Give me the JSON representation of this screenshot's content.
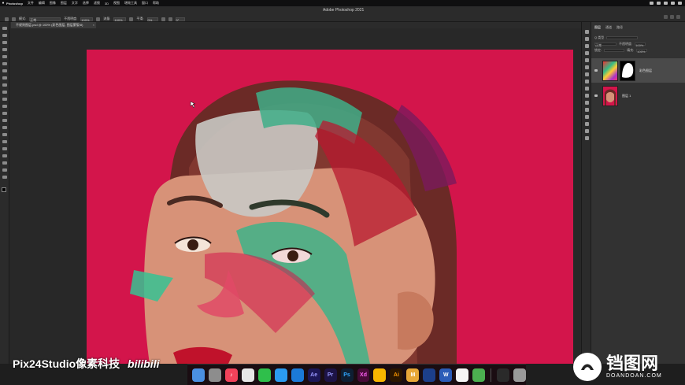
{
  "menubar": {
    "app": "Photoshop",
    "items": [
      "文件",
      "编辑",
      "图像",
      "图层",
      "文字",
      "选择",
      "滤镜",
      "3D",
      "视图",
      "增效工具",
      "窗口",
      "帮助"
    ]
  },
  "optionsbar": {
    "app_title": "Adobe Photoshop 2021",
    "mode_label": "模式:",
    "mode_value": "正常",
    "opacity_label": "不透明度:",
    "opacity_value": "100%",
    "flow_label": "流量:",
    "flow_value": "100%",
    "smoothing_label": "平滑:",
    "smoothing_value": "0%",
    "angle_value": "0°"
  },
  "tab": {
    "label": "不规则图层.psd @ 100% (彩色图层, 图层蒙版/8)",
    "close": "×"
  },
  "layers_panel": {
    "tabs": [
      "图层",
      "通道",
      "路径"
    ],
    "kind_label": "Q 类型",
    "blend_mode": "正常",
    "opacity_label": "不透明度:",
    "opacity_value": "100%",
    "lock_label": "锁定:",
    "fill_label": "填充:",
    "fill_value": "100%",
    "layers": [
      {
        "name": "彩色图层",
        "selected": true
      },
      {
        "name": "图层 1",
        "selected": false
      }
    ]
  },
  "dock": {
    "apps": [
      {
        "icon": "finder-icon",
        "label": "",
        "color": "#4a8fe0"
      },
      {
        "icon": "launchpad-icon",
        "label": "",
        "color": "#8d8d8d"
      },
      {
        "icon": "music-icon",
        "label": "♪",
        "color": "#f2425a"
      },
      {
        "icon": "chrome-icon",
        "label": "",
        "color": "#e7e7e7"
      },
      {
        "icon": "wechat-icon",
        "label": "",
        "color": "#2fbf4b"
      },
      {
        "icon": "qq-icon",
        "label": "",
        "color": "#2b9bf0"
      },
      {
        "icon": "safari-icon",
        "label": "",
        "color": "#1b7ad8"
      },
      {
        "icon": "after-effects-icon",
        "label": "Ae",
        "color": "#1b1757"
      },
      {
        "icon": "premiere-icon",
        "label": "Pr",
        "color": "#1d1346"
      },
      {
        "icon": "photoshop-icon",
        "label": "Ps",
        "color": "#0e1f33"
      },
      {
        "icon": "xd-icon",
        "label": "Xd",
        "color": "#470a37"
      },
      {
        "icon": "sketch-icon",
        "label": "",
        "color": "#f7b500"
      },
      {
        "icon": "illustrator-icon",
        "label": "Ai",
        "color": "#2b1600"
      },
      {
        "icon": "m-app-icon",
        "label": "M",
        "color": "#e8a838"
      },
      {
        "icon": "c4d-icon",
        "label": "",
        "color": "#1c3f8a"
      },
      {
        "icon": "word-icon",
        "label": "W",
        "color": "#2b5cb8"
      },
      {
        "icon": "notes-icon",
        "label": "",
        "color": "#f5f5f5"
      },
      {
        "icon": "camtasia-icon",
        "label": "",
        "color": "#4caf50"
      },
      {
        "icon": "terminal-icon",
        "label": "",
        "color": "#2a2a2a"
      },
      {
        "icon": "trash-icon",
        "label": "",
        "color": "#9a9a9a"
      }
    ]
  },
  "watermark": {
    "left_text": "Pix24Studio像素科技",
    "bilibili": "bilibili",
    "brand": "铛图网",
    "url": "DOANDOAN.COM"
  }
}
